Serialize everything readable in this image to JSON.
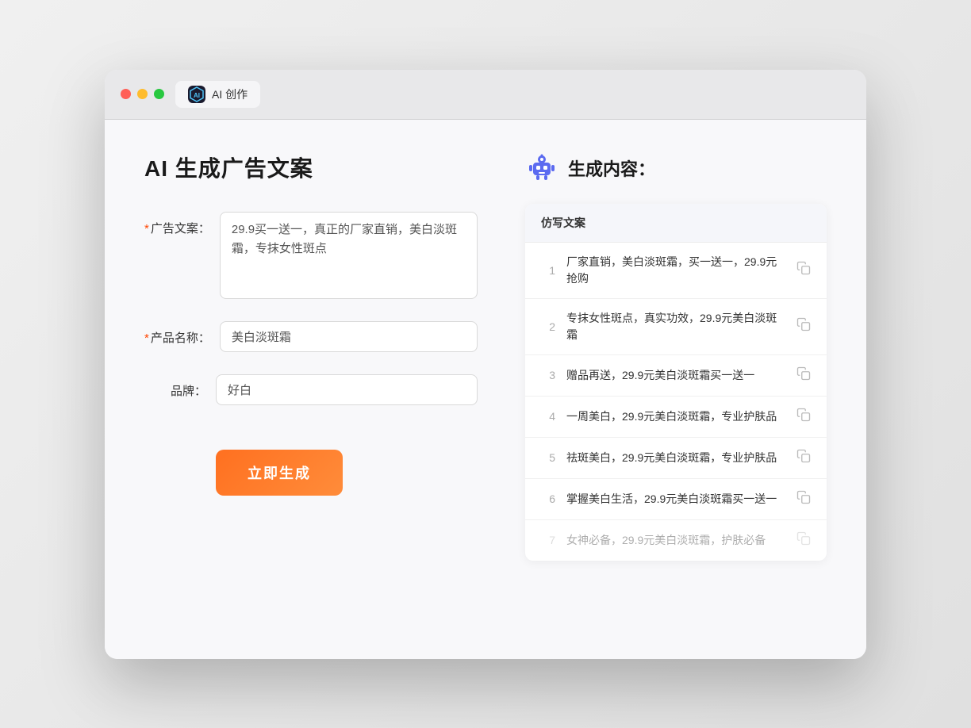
{
  "browser": {
    "tab_label": "AI 创作",
    "tab_icon": "AI"
  },
  "page": {
    "title": "AI 生成广告文案"
  },
  "form": {
    "ad_copy_label": "广告文案：",
    "ad_copy_required": "*",
    "ad_copy_value": "29.9买一送一，真正的厂家直销，美白淡斑霜，专抹女性斑点",
    "product_label": "产品名称：",
    "product_required": "*",
    "product_value": "美白淡斑霜",
    "brand_label": "品牌：",
    "brand_value": "好白",
    "generate_button": "立即生成"
  },
  "result": {
    "header_title": "生成内容：",
    "table_header": "仿写文案",
    "rows": [
      {
        "num": "1",
        "text": "厂家直销，美白淡斑霜，买一送一，29.9元抢购",
        "dimmed": false
      },
      {
        "num": "2",
        "text": "专抹女性斑点，真实功效，29.9元美白淡斑霜",
        "dimmed": false
      },
      {
        "num": "3",
        "text": "赠品再送，29.9元美白淡斑霜买一送一",
        "dimmed": false
      },
      {
        "num": "4",
        "text": "一周美白，29.9元美白淡斑霜，专业护肤品",
        "dimmed": false
      },
      {
        "num": "5",
        "text": "祛斑美白，29.9元美白淡斑霜，专业护肤品",
        "dimmed": false
      },
      {
        "num": "6",
        "text": "掌握美白生活，29.9元美白淡斑霜买一送一",
        "dimmed": false
      },
      {
        "num": "7",
        "text": "女神必备，29.9元美白淡斑霜，护肤必备",
        "dimmed": true
      }
    ]
  }
}
